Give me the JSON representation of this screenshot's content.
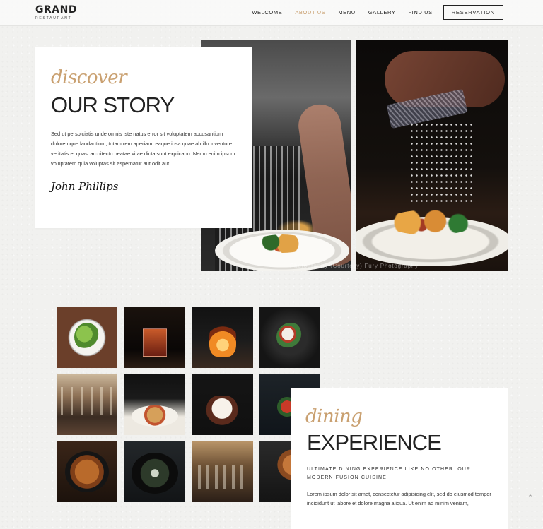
{
  "header": {
    "logo_main": "GRAND",
    "logo_sub": "RESTAURANT",
    "nav": [
      "WELCOME",
      "ABOUT US",
      "MENU",
      "GALLERY",
      "FIND US"
    ],
    "active_nav": "ABOUT US",
    "reservation_label": "RESERVATION"
  },
  "story": {
    "script": "discover",
    "heading": "OUR STORY",
    "body": "Sed ut perspiciatis unde omnis iste natus error sit voluptatem accusantium doloremque laudantium, totam rem aperiam, eaque ipsa quae ab illo inventore veritatis et quasi architecto beatae vitae dicta sunt explicabo. Nemo enim ipsum voluptatem quia voluptas sit aspernatur aut odit aut",
    "signature": "John Phillips"
  },
  "photos": {
    "credit": "Photography (Courtesy) Fury Photography"
  },
  "gallery": {
    "thumbnails": [
      "salad-dish",
      "cocktail",
      "grilled-steak",
      "plated-appetizer",
      "restaurant-interior",
      "pasta-plate",
      "dessert-glass",
      "dark-table-dish",
      "roast-chicken",
      "squid-ink-dish",
      "dining-room",
      "grilled-meat"
    ]
  },
  "dining": {
    "script": "dining",
    "heading": "EXPERIENCE",
    "tagline": "ULTIMATE DINING EXPERIENCE LIKE NO OTHER. OUR MODERN FUSION CUISINE",
    "body": "Lorem ipsum dolor sit amet, consectetur adipisicing elit, sed do eiusmod tempor incididunt ut labore et dolore magna aliqua. Ut enim ad minim veniam,"
  },
  "colors": {
    "accent": "#c9a070",
    "text": "#222222",
    "background": "#f1f1ef"
  }
}
